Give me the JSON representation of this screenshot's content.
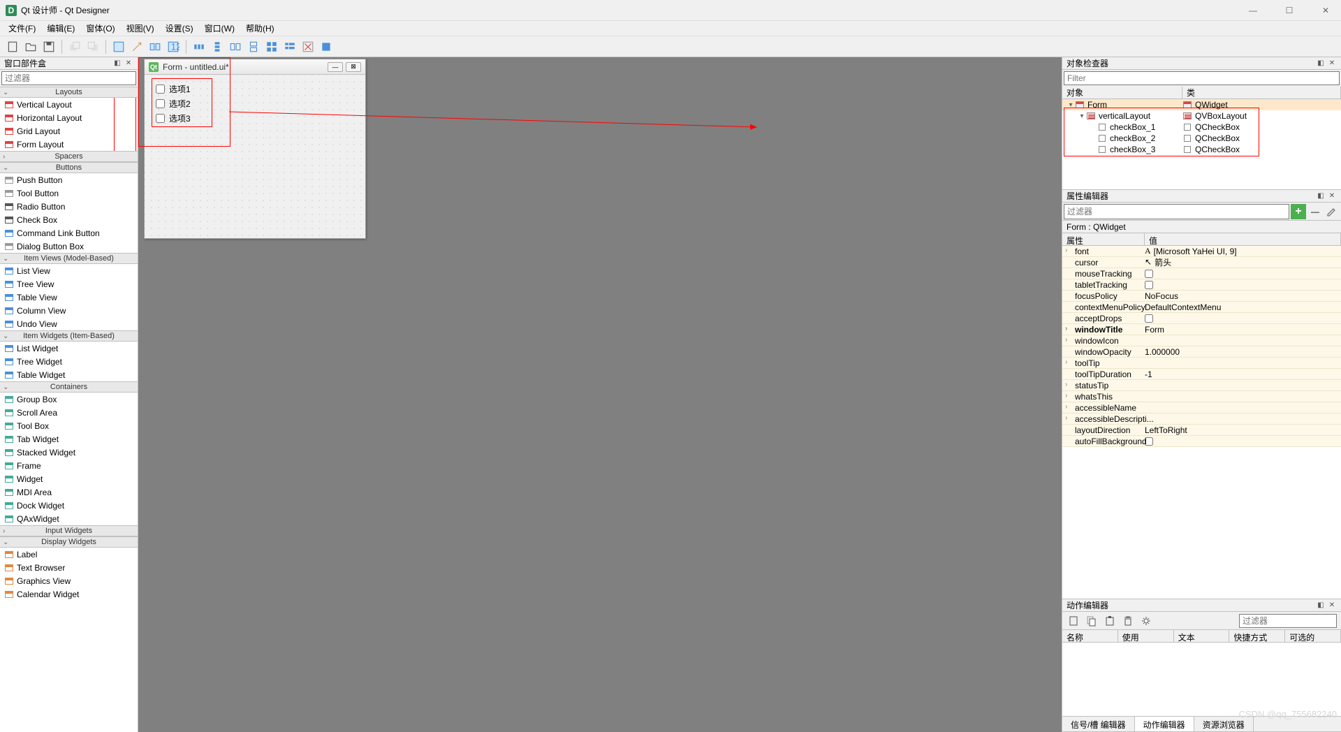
{
  "title": "Qt 设计师 - Qt Designer",
  "menus": [
    "文件(F)",
    "编辑(E)",
    "窗体(O)",
    "视图(V)",
    "设置(S)",
    "窗口(W)",
    "帮助(H)"
  ],
  "widgetbox": {
    "title": "窗口部件盒",
    "filter_placeholder": "过滤器",
    "categories": [
      {
        "name": "Layouts",
        "items": [
          "Vertical Layout",
          "Horizontal Layout",
          "Grid Layout",
          "Form Layout"
        ]
      },
      {
        "name": "Spacers",
        "items": []
      },
      {
        "name": "Buttons",
        "items": [
          "Push Button",
          "Tool Button",
          "Radio Button",
          "Check Box",
          "Command Link Button",
          "Dialog Button Box"
        ]
      },
      {
        "name": "Item Views (Model-Based)",
        "items": [
          "List View",
          "Tree View",
          "Table View",
          "Column View",
          "Undo View"
        ]
      },
      {
        "name": "Item Widgets (Item-Based)",
        "items": [
          "List Widget",
          "Tree Widget",
          "Table Widget"
        ]
      },
      {
        "name": "Containers",
        "items": [
          "Group Box",
          "Scroll Area",
          "Tool Box",
          "Tab Widget",
          "Stacked Widget",
          "Frame",
          "Widget",
          "MDI Area",
          "Dock Widget",
          "QAxWidget"
        ]
      },
      {
        "name": "Input Widgets",
        "items": []
      },
      {
        "name": "Display Widgets",
        "items": [
          "Label",
          "Text Browser",
          "Graphics View",
          "Calendar Widget"
        ]
      }
    ]
  },
  "form": {
    "title": "Form - untitled.ui*",
    "checkboxes": [
      "选项1",
      "选项2",
      "选项3"
    ]
  },
  "inspector": {
    "title": "对象检查器",
    "filter_placeholder": "Filter",
    "cols": [
      "对象",
      "类"
    ],
    "rows": [
      {
        "indent": 0,
        "toggle": "▾",
        "name": "Form",
        "cls": "QWidget",
        "icon": "form",
        "selected": true
      },
      {
        "indent": 1,
        "toggle": "▾",
        "name": "verticalLayout",
        "cls": "QVBoxLayout",
        "icon": "layout"
      },
      {
        "indent": 2,
        "toggle": "",
        "name": "checkBox_1",
        "cls": "QCheckBox",
        "icon": "check"
      },
      {
        "indent": 2,
        "toggle": "",
        "name": "checkBox_2",
        "cls": "QCheckBox",
        "icon": "check"
      },
      {
        "indent": 2,
        "toggle": "",
        "name": "checkBox_3",
        "cls": "QCheckBox",
        "icon": "check"
      }
    ]
  },
  "properties": {
    "title": "属性编辑器",
    "filter_placeholder": "过滤器",
    "context": "Form : QWidget",
    "cols": [
      "属性",
      "值"
    ],
    "rows": [
      {
        "name": "font",
        "value": "[Microsoft YaHei UI, 9]",
        "exp": "›",
        "prefix": "A"
      },
      {
        "name": "cursor",
        "value": "箭头",
        "prefix": "↖"
      },
      {
        "name": "mouseTracking",
        "value": "",
        "checkbox": true
      },
      {
        "name": "tabletTracking",
        "value": "",
        "checkbox": true
      },
      {
        "name": "focusPolicy",
        "value": "NoFocus"
      },
      {
        "name": "contextMenuPolicy",
        "value": "DefaultContextMenu"
      },
      {
        "name": "acceptDrops",
        "value": "",
        "checkbox": true
      },
      {
        "name": "windowTitle",
        "value": "Form",
        "exp": "›",
        "bold": true
      },
      {
        "name": "windowIcon",
        "value": "",
        "exp": "›"
      },
      {
        "name": "windowOpacity",
        "value": "1.000000"
      },
      {
        "name": "toolTip",
        "value": "",
        "exp": "›"
      },
      {
        "name": "toolTipDuration",
        "value": "-1"
      },
      {
        "name": "statusTip",
        "value": "",
        "exp": "›"
      },
      {
        "name": "whatsThis",
        "value": "",
        "exp": "›"
      },
      {
        "name": "accessibleName",
        "value": "",
        "exp": "›"
      },
      {
        "name": "accessibleDescripti...",
        "value": "",
        "exp": "›"
      },
      {
        "name": "layoutDirection",
        "value": "LeftToRight"
      },
      {
        "name": "autoFillBackground",
        "value": "",
        "checkbox": true
      }
    ]
  },
  "actions": {
    "title": "动作编辑器",
    "filter_placeholder": "过滤器",
    "cols": [
      "名称",
      "使用",
      "文本",
      "快捷方式",
      "可选的"
    ],
    "tabs": [
      "信号/槽 编辑器",
      "动作编辑器",
      "资源浏览器"
    ],
    "active_tab": 1
  },
  "watermark": "CSDN @qq_755682240"
}
